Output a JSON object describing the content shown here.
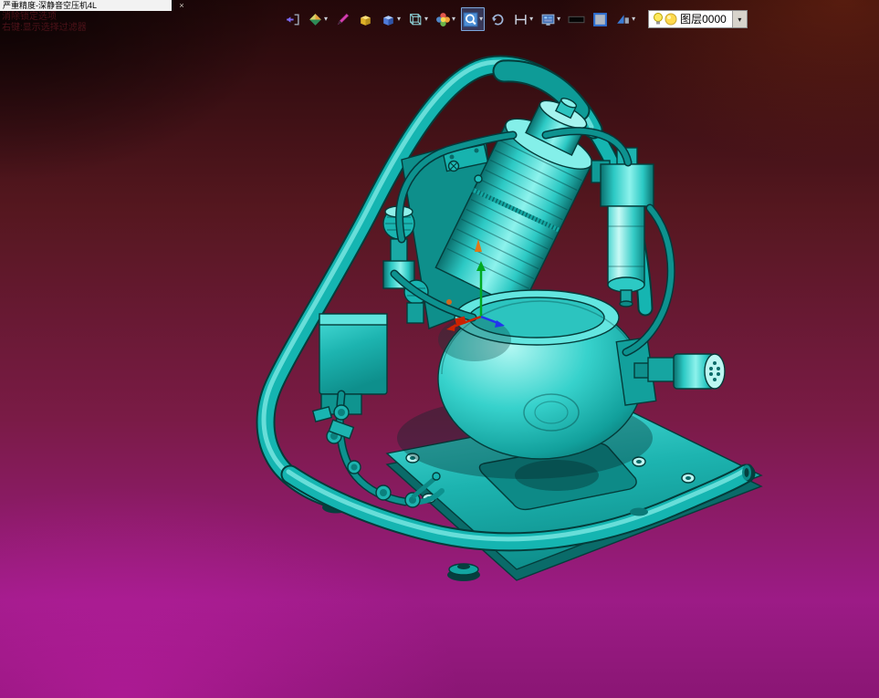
{
  "window": {
    "tab_title": "严重精度-深静音空压机4L",
    "close_glyph": "×"
  },
  "overlay_hints": {
    "line1": "消除锁定选项",
    "line2": "右键:显示选择过滤器"
  },
  "toolbar": {
    "dropdown_glyph": "▾",
    "items": [
      {
        "name": "exit",
        "dropdown": false
      },
      {
        "name": "material-style",
        "dropdown": true
      },
      {
        "name": "pen",
        "dropdown": false
      },
      {
        "name": "solid-box",
        "dropdown": false
      },
      {
        "name": "blue-cube",
        "dropdown": true
      },
      {
        "name": "wireframe-cube",
        "dropdown": true
      },
      {
        "name": "render-palette",
        "dropdown": true
      },
      {
        "name": "zoom",
        "dropdown": true,
        "active": true
      },
      {
        "name": "refresh",
        "dropdown": false
      },
      {
        "name": "measure",
        "dropdown": true
      },
      {
        "name": "screen-grid",
        "dropdown": true
      },
      {
        "name": "line-width",
        "dropdown": false
      },
      {
        "name": "color-swatch",
        "dropdown": false
      },
      {
        "name": "visibility",
        "dropdown": true
      }
    ],
    "layer_combo": {
      "value": "图层0000"
    }
  },
  "viewport": {
    "model_color": "#1fc8c4",
    "triad": {
      "x_color": "#cc2200",
      "y_color": "#00aa22",
      "z_color": "#2233ee"
    },
    "background": {
      "top_left": "#1a0607",
      "top_right": "#5e1d16",
      "bottom_left": "#b01da0",
      "bottom_right": "#7c1560"
    }
  }
}
